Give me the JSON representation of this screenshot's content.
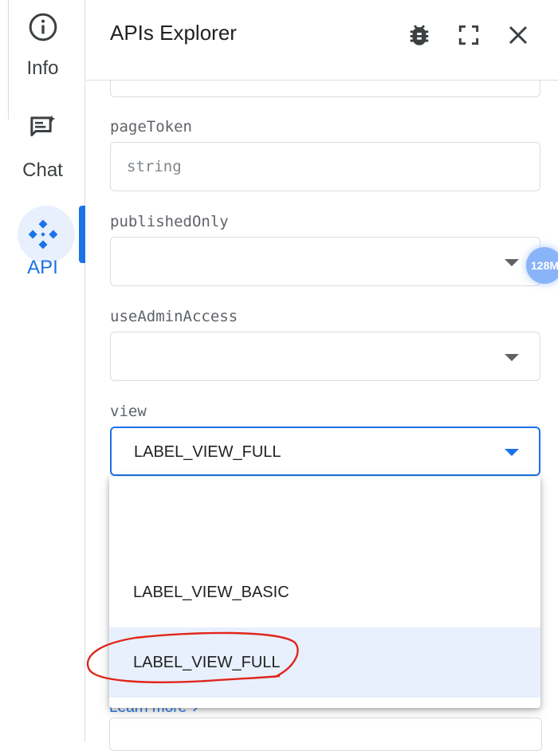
{
  "rail": {
    "items": [
      {
        "label": "Info",
        "icon": "info-icon"
      },
      {
        "label": "Chat",
        "icon": "chat-icon"
      },
      {
        "label": "API",
        "icon": "api-icon",
        "active": true
      }
    ]
  },
  "header": {
    "title": "APIs Explorer",
    "icons": [
      "bug-icon",
      "fullscreen-icon",
      "close-icon"
    ]
  },
  "form": {
    "fields": [
      {
        "label": "pageToken",
        "type": "text",
        "placeholder": "string",
        "value": ""
      },
      {
        "label": "publishedOnly",
        "type": "select",
        "value": ""
      },
      {
        "label": "useAdminAccess",
        "type": "select",
        "value": ""
      },
      {
        "label": "view",
        "type": "select",
        "value": "LABEL_VIEW_FULL",
        "focused": true
      }
    ]
  },
  "dropdown": {
    "options": [
      "",
      "LABEL_VIEW_BASIC",
      "LABEL_VIEW_FULL"
    ],
    "selected": "LABEL_VIEW_FULL"
  },
  "badge": {
    "text": "128M"
  },
  "footer": {
    "link": "Learn more"
  },
  "colors": {
    "accent": "#1a73e8",
    "selected_bg": "#e8f0fe",
    "annotation": "#e0261b"
  }
}
